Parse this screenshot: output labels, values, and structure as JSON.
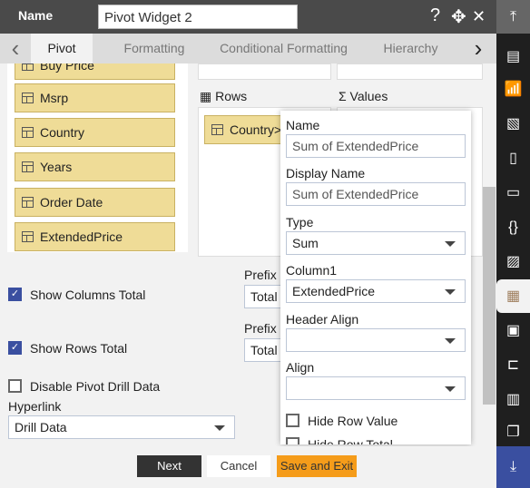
{
  "header": {
    "name_label": "Name",
    "name_value": "Pivot Widget 2",
    "help": "?",
    "move": "✥",
    "close": "✕"
  },
  "tabs": {
    "prev": "‹",
    "next": "›",
    "items": [
      {
        "label": "Pivot"
      },
      {
        "label": "Formatting"
      },
      {
        "label": "Conditional Formatting"
      },
      {
        "label": "Hierarchy"
      }
    ]
  },
  "fields": [
    "Buy Price",
    "Msrp",
    "Country",
    "Years",
    "Order Date",
    "ExtendedPrice"
  ],
  "rows": {
    "label": "Rows",
    "items": [
      "Country"
    ]
  },
  "values": {
    "label": "Values"
  },
  "options": {
    "show_columns_total": {
      "label": "Show Columns Total",
      "checked": true
    },
    "show_rows_total": {
      "label": "Show Rows Total",
      "checked": true
    },
    "disable_drill": {
      "label": "Disable Pivot Drill Data",
      "checked": false
    },
    "hyperlink_label": "Hyperlink",
    "hyperlink_value": "Drill Data",
    "prefix_col_label": "Prefix C",
    "prefix_col_value": "Total",
    "prefix_row_label": "Prefix R",
    "prefix_row_value": "Total"
  },
  "popup": {
    "name_label": "Name",
    "name_value": "Sum of ExtendedPrice",
    "display_label": "Display Name",
    "display_value": "Sum of ExtendedPrice",
    "type_label": "Type",
    "type_value": "Sum",
    "column_label": "Column1",
    "column_value": "ExtendedPrice",
    "header_align_label": "Header Align",
    "header_align_value": "",
    "align_label": "Align",
    "align_value": "",
    "hide_row_value": "Hide Row Value",
    "hide_row_total": "Hide Row Total"
  },
  "footer": {
    "next": "Next",
    "cancel": "Cancel",
    "save": "Save and Exit"
  },
  "colors": {
    "accent": "#3a4fa0",
    "save": "#f59c1a",
    "field": "#efdc97"
  }
}
